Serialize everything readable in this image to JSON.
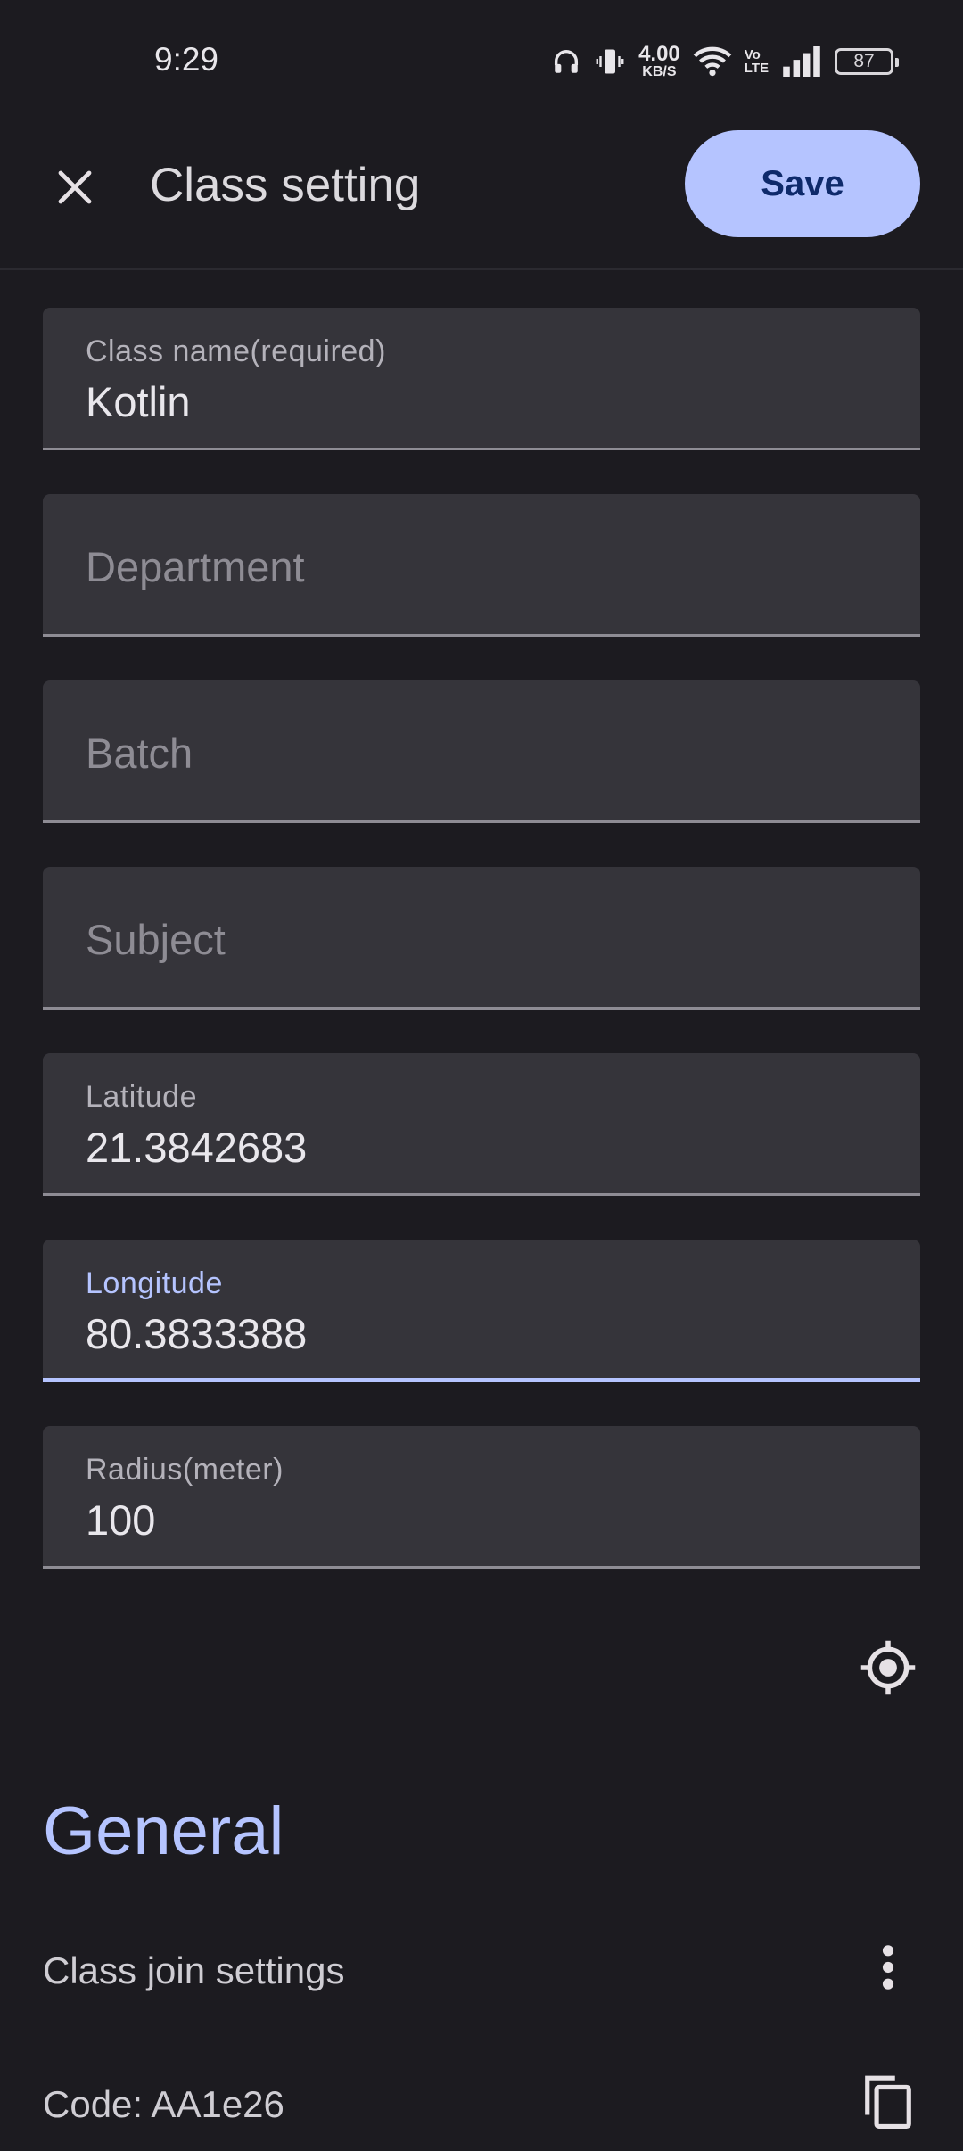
{
  "status_bar": {
    "time": "9:29",
    "net_speed_value": "4.00",
    "net_speed_unit": "KB/S",
    "volte_top": "Vo",
    "volte_bottom": "LTE",
    "battery": "87"
  },
  "app_bar": {
    "title": "Class setting",
    "save_label": "Save",
    "close_icon": "close-icon"
  },
  "fields": {
    "class_name": {
      "label": "Class name(required)",
      "value": "Kotlin"
    },
    "department": {
      "placeholder": "Department"
    },
    "batch": {
      "placeholder": "Batch"
    },
    "subject": {
      "placeholder": "Subject"
    },
    "latitude": {
      "label": "Latitude",
      "value": "21.3842683"
    },
    "longitude": {
      "label": "Longitude",
      "value": "80.3833388",
      "focused": true
    },
    "radius": {
      "label": "Radius(meter)",
      "value": "100"
    }
  },
  "location_button_icon": "my-location-icon",
  "general": {
    "title": "General",
    "join_settings_label": "Class join settings",
    "join_settings_icon": "more-vert-icon",
    "code_label": "Code: AA1e26",
    "code_icon": "copy-icon"
  },
  "colors": {
    "background": "#1c1b20",
    "field_background": "#35343a",
    "accent": "#b5c4ff",
    "save_text": "#0e2a6b"
  }
}
